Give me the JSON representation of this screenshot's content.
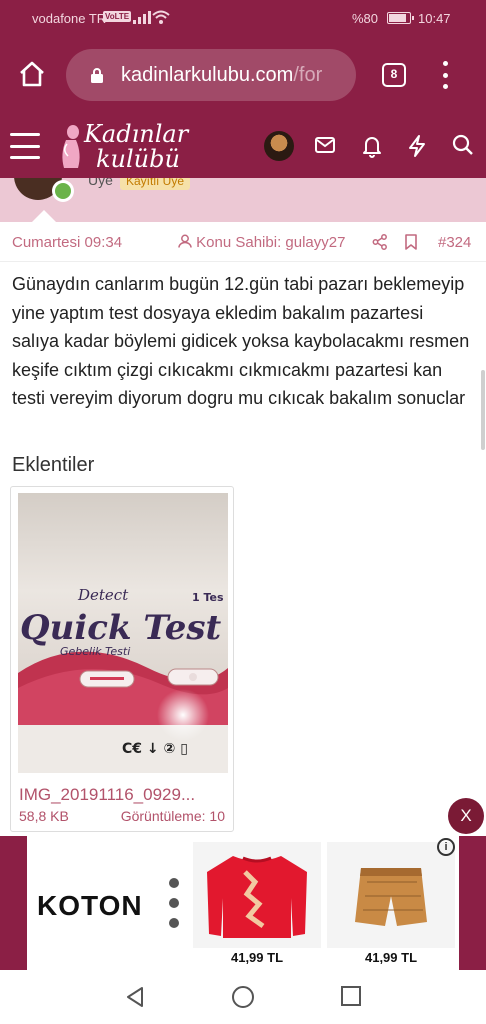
{
  "status_bar": {
    "carrier": "vodafone TR",
    "volte": "VoLTE",
    "battery_percent": "%80",
    "time": "10:47"
  },
  "browser": {
    "url_main": "kadinlarkulubu.com",
    "url_rest": "/for",
    "tab_count": "8"
  },
  "site": {
    "logo_line1": "Kadınlar",
    "logo_line2": "kulübü"
  },
  "profile": {
    "role": "Üye",
    "badge": "Kayıtlı Üye"
  },
  "post": {
    "date": "Cumartesi 09:34",
    "owner": "Konu Sahibi: gulayy27",
    "number": "#324",
    "text": "Günaydın canlarım bugün 12.gün tabi pazarı beklemeyip yine yaptım test dosyaya ekledim bakalım pazartesi salıya kadar böylemi gidicek yoksa kaybolacakmı resmen keşife cıktım çizgi cıkıcakmı cıkmıcakmı pazartesi kan testi vereyim diyorum dogru mu cıkıcak bakalım sonuclar"
  },
  "attachments": {
    "title": "Eklentiler",
    "items": [
      {
        "filename": "IMG_20191116_0929...",
        "size": "58,8 KB",
        "views": "Görüntüleme: 10",
        "photo_text": {
          "brand": "Detect",
          "product": "Quick Test",
          "count": "1 Tes",
          "sub": "Gebelik Testi"
        }
      }
    ]
  },
  "ad": {
    "brand": "KOTON",
    "products": [
      {
        "price": "41,99 TL"
      },
      {
        "price": "41,99 TL"
      }
    ],
    "info_symbol": "i",
    "close_label": "X"
  },
  "colors": {
    "brand": "#8b1f45",
    "accent_text": "#c26a80",
    "profile_strip": "#ecc8d4"
  }
}
